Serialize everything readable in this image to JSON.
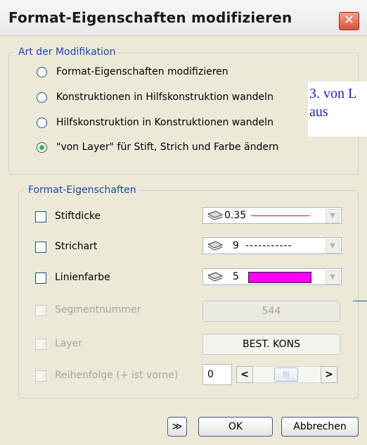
{
  "window": {
    "title": "Format-Eigenschaften modifizieren",
    "close_symbol": "✕"
  },
  "modification": {
    "legend": "Art der Modifikation",
    "options": [
      {
        "label": "Format-Eigenschaften modifizieren",
        "selected": false
      },
      {
        "label": "Konstruktionen in Hilfskonstruktion wandeln",
        "selected": false
      },
      {
        "label": "Hilfskonstruktion in Konstruktionen wandeln",
        "selected": false
      },
      {
        "label": "\"von Layer\" für Stift, Strich und Farbe ändern",
        "selected": true
      }
    ]
  },
  "format": {
    "legend": "Format-Eigenschaften",
    "stiftdicke": {
      "label": "Stiftdicke",
      "value": "0.35"
    },
    "strichart": {
      "label": "Strichart",
      "value": "9",
      "pattern": "-----------"
    },
    "linienfarbe": {
      "label": "Linienfarbe",
      "value": "5",
      "color": "#ff00ff"
    },
    "segmentnummer": {
      "label": "Segmentnummer",
      "value": "544"
    },
    "layer": {
      "label": "Layer",
      "value": "BEST. KONS"
    },
    "reihenfolge": {
      "label": "Reihenfolge (+ ist vorne)",
      "value": "0"
    }
  },
  "buttons": {
    "expand": "≫",
    "ok": "OK",
    "cancel": "Abbrechen"
  },
  "annotation": {
    "line1": "3. von L",
    "line2": "aus"
  }
}
